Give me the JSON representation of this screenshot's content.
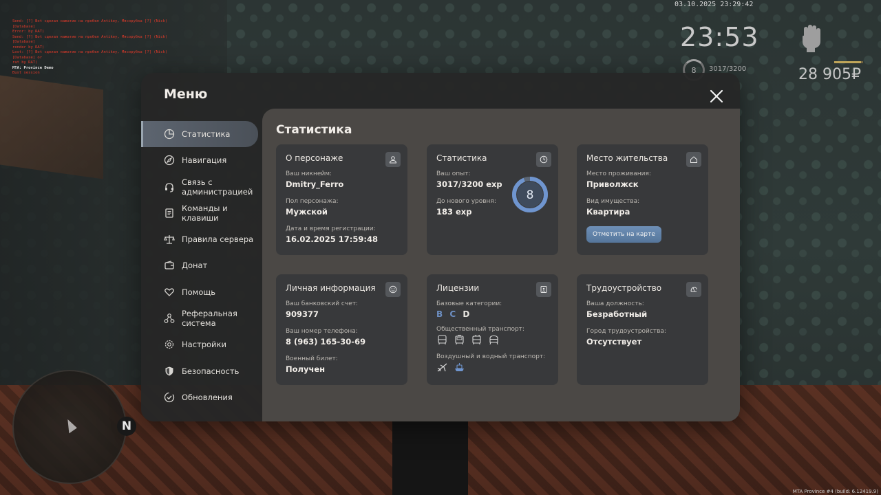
{
  "hud": {
    "datetime": "03.10.2025 23:29:42",
    "clock": "23:53",
    "level": "8",
    "exp": "3017/3200",
    "exp_fraction": 0.94,
    "money": "28 905₽"
  },
  "debug": {
    "lines": [
      "Send: [?] Bot сделал нажатие на пробел Antikey, Мясорубка [?] (Nick) [Database]",
      "Error: by RAT)",
      "Send: [?] Bot сделал нажатие на пробел Antikey, Мясорубка [?] (Nick) [Database]",
      "render by RAT)",
      "Lost: [?] Bot сделал нажатие на пробел Antikey, Мясорубка [?] (Nick) [Database] or",
      "rat by RAT)"
    ],
    "server": "MTA: Province Demo",
    "sub": "Bust session"
  },
  "build": "MTA Province #4 (build: 6.12419.9)",
  "minimap": {
    "north": "N"
  },
  "menu": {
    "title": "Меню",
    "sidebar": [
      {
        "label": "Статистика",
        "icon": "pie-chart-icon",
        "active": true
      },
      {
        "label": "Навигация",
        "icon": "compass-icon"
      },
      {
        "label": "Связь с администрацией",
        "icon": "headset-icon"
      },
      {
        "label": "Команды и клавиши",
        "icon": "document-icon"
      },
      {
        "label": "Правила сервера",
        "icon": "scales-icon"
      },
      {
        "label": "Донат",
        "icon": "wallet-icon"
      },
      {
        "label": "Помощь",
        "icon": "heart-hand-icon"
      },
      {
        "label": "Реферальная система",
        "icon": "network-icon"
      },
      {
        "label": "Настройки",
        "icon": "gear-icon"
      },
      {
        "label": "Безопасность",
        "icon": "shield-icon"
      },
      {
        "label": "Обновления",
        "icon": "check-circle-icon"
      }
    ],
    "content_title": "Статистика",
    "cards": {
      "character": {
        "title": "О персонаже",
        "icon": "user-icon",
        "nickname_label": "Ваш никнейм:",
        "nickname": "Dmitry_Ferro",
        "gender_label": "Пол персонажа:",
        "gender": "Мужской",
        "reg_label": "Дата и время регистрации:",
        "reg": "16.02.2025 17:59:48"
      },
      "stats": {
        "title": "Статистика",
        "icon": "clock-icon",
        "exp_label": "Ваш опыт:",
        "exp": "3017/3200 exp",
        "next_label": "До нового уровня:",
        "next": "183 exp",
        "level": "8",
        "level_progress": 0.94
      },
      "residence": {
        "title": "Место жительства",
        "icon": "house-icon",
        "place_label": "Место проживания:",
        "place": "Приволжск",
        "prop_label": "Вид имущества:",
        "prop": "Квартира",
        "button": "Отметить на карте"
      },
      "personal": {
        "title": "Личная информация",
        "icon": "face-icon",
        "bank_label": "Ваш банковский счет:",
        "bank": "909377",
        "phone_label": "Ваш номер телефона:",
        "phone": "8 (963) 165-30-69",
        "military_label": "Военный билет:",
        "military": "Получен"
      },
      "licenses": {
        "title": "Лицензии",
        "icon": "id-card-icon",
        "basic_label": "Базовые категории:",
        "categories": [
          {
            "label": "B",
            "owned": true
          },
          {
            "label": "C",
            "owned": true
          },
          {
            "label": "D",
            "owned": false
          }
        ],
        "public_label": "Общественный транспорт:",
        "air_label": "Воздушный и водный транспорт:"
      },
      "employment": {
        "title": "Трудоустройство",
        "icon": "helmet-icon",
        "position_label": "Ваша должность:",
        "position": "Безработный",
        "city_label": "Город трудоустройства:",
        "city": "Отсутствует"
      }
    }
  }
}
